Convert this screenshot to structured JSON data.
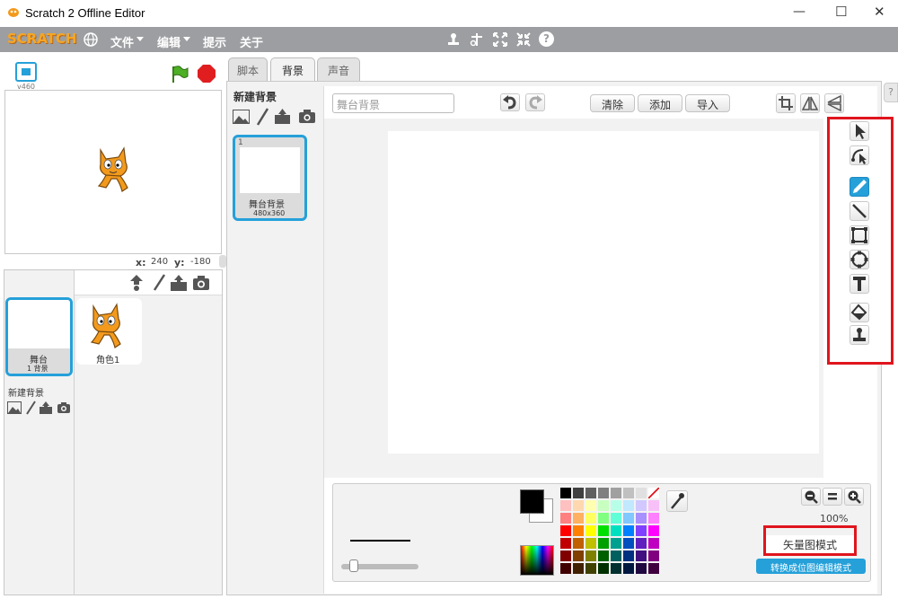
{
  "window": {
    "title": "Scratch 2 Offline Editor",
    "minimize": "—",
    "maximize": "☐",
    "close": "✕"
  },
  "menu": {
    "logo": "SCRATCH",
    "file": "文件",
    "edit": "编辑",
    "tips": "提示",
    "about": "关于"
  },
  "stage": {
    "version": "v460",
    "x_label": "x:",
    "x_value": "240",
    "y_label": "y:",
    "y_value": "-180"
  },
  "sprites": {
    "stage_tile_label": "舞台",
    "stage_tile_sub": "1 背景",
    "sprite1_label": "角色1",
    "new_backdrop_label": "新建背景"
  },
  "tabs": {
    "scripts": "脚本",
    "backdrops": "背景",
    "sounds": "声音"
  },
  "backdrop_list": {
    "header": "新建背景",
    "item_index": "1",
    "item_name": "舞台背景",
    "item_size": "480x360"
  },
  "editor": {
    "name_field": "舞台背景",
    "clear": "清除",
    "add": "添加",
    "import": "导入",
    "zoom": "100%",
    "mode_label": "矢量图模式",
    "convert_label": "转换成位图编辑模式"
  },
  "colors": {
    "accent": "#25a0d9",
    "highlight_red": "#e0151d",
    "menubar": "#9c9ea1"
  }
}
